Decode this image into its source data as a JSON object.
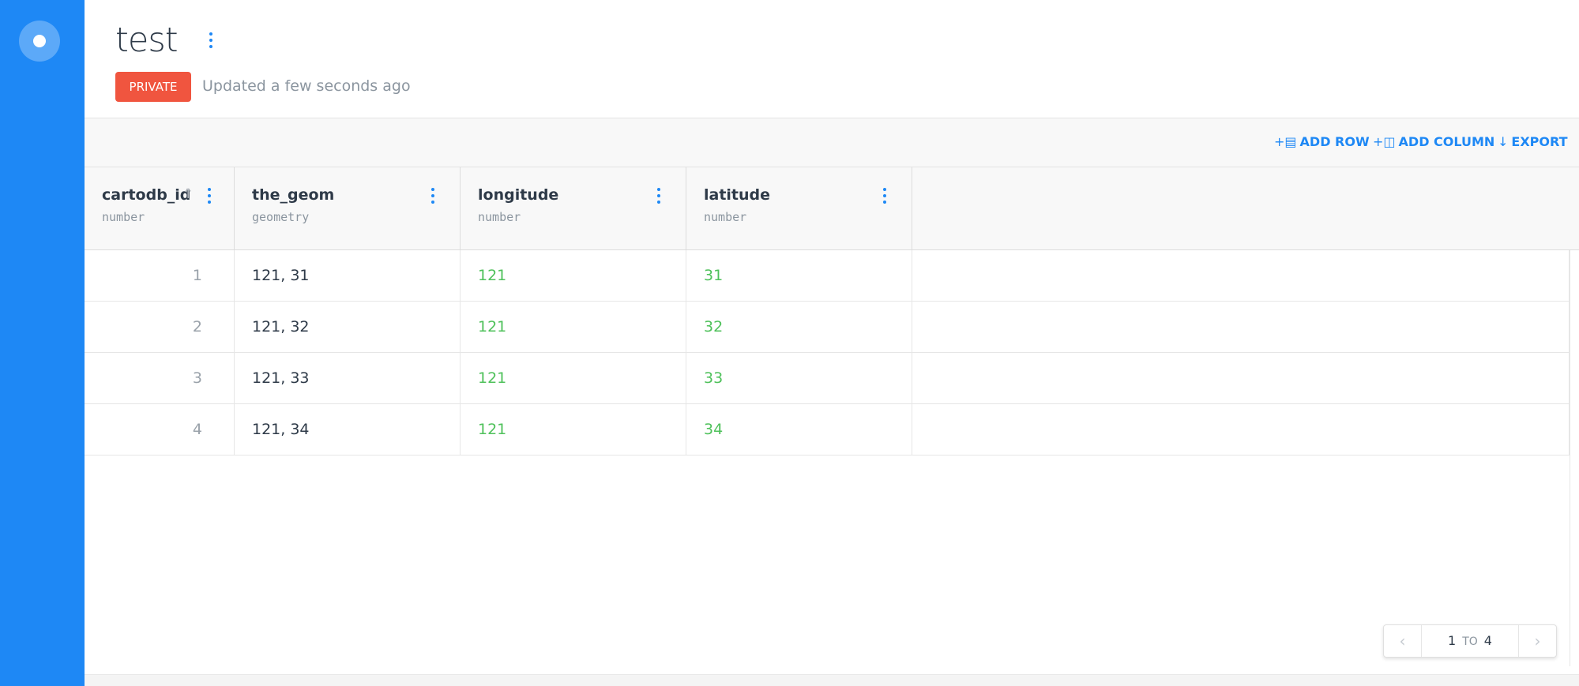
{
  "header": {
    "title": "test",
    "privacy_badge": "PRIVATE",
    "updated_text": "Updated a few seconds ago"
  },
  "toolbar": {
    "add_row": "ADD ROW",
    "add_column": "ADD COLUMN",
    "export": "EXPORT"
  },
  "columns": [
    {
      "name": "cartodb_id",
      "type": "number",
      "sorted": "ascending"
    },
    {
      "name": "the_geom",
      "type": "geometry"
    },
    {
      "name": "longitude",
      "type": "number"
    },
    {
      "name": "latitude",
      "type": "number"
    }
  ],
  "rows": [
    {
      "cartodb_id": "1",
      "the_geom": "121, 31",
      "longitude": "121",
      "latitude": "31"
    },
    {
      "cartodb_id": "2",
      "the_geom": "121, 32",
      "longitude": "121",
      "latitude": "32"
    },
    {
      "cartodb_id": "3",
      "the_geom": "121, 33",
      "longitude": "121",
      "latitude": "33"
    },
    {
      "cartodb_id": "4",
      "the_geom": "121, 34",
      "longitude": "121",
      "latitude": "34"
    }
  ],
  "pagination": {
    "from": "1",
    "to_label": "TO",
    "to": "4"
  },
  "colors": {
    "sidebar": "#1e88f5",
    "accent": "#1e88f5",
    "private_badge": "#f0553f",
    "numeric_value": "#4fc15b"
  }
}
